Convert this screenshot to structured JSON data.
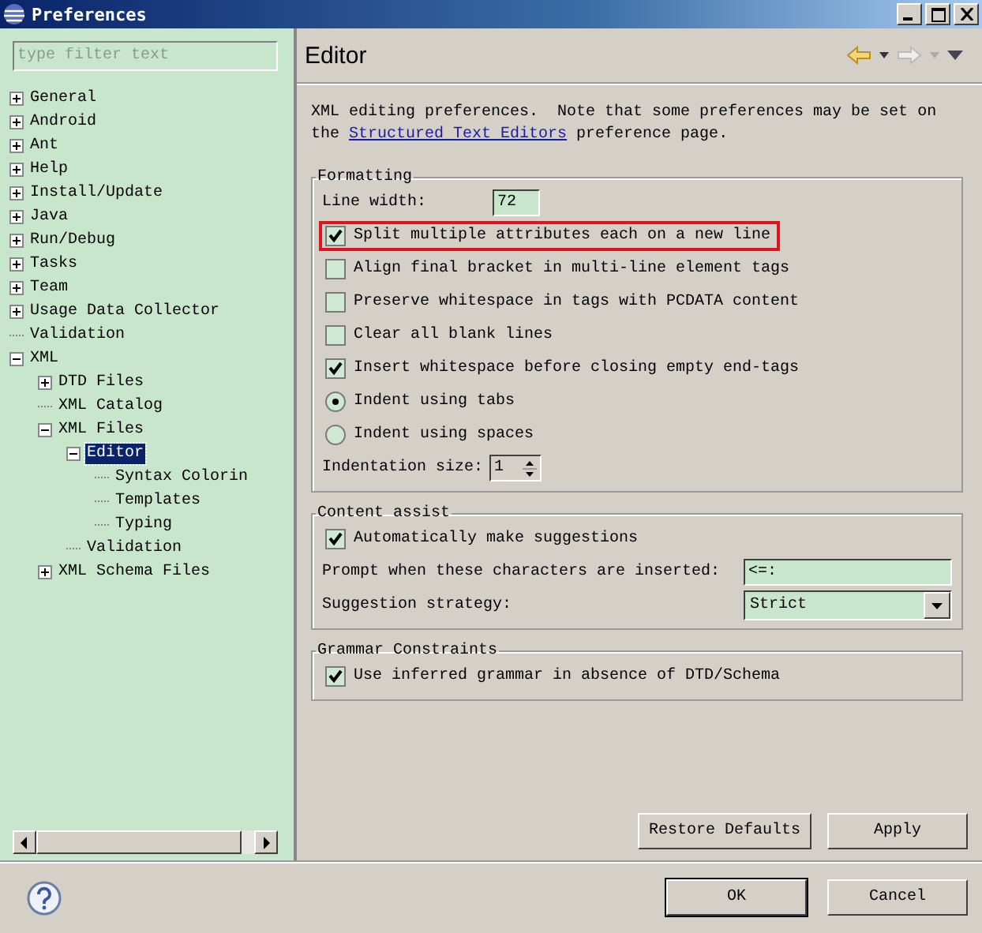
{
  "window": {
    "title": "Preferences"
  },
  "filter": {
    "placeholder": "type filter text"
  },
  "tree": {
    "items": [
      {
        "label": "General",
        "kind": "folder",
        "expanded": false,
        "selected": false
      },
      {
        "label": "Android",
        "kind": "folder",
        "expanded": false,
        "selected": false
      },
      {
        "label": "Ant",
        "kind": "folder",
        "expanded": false,
        "selected": false
      },
      {
        "label": "Help",
        "kind": "folder",
        "expanded": false,
        "selected": false
      },
      {
        "label": "Install/Update",
        "kind": "folder",
        "expanded": false,
        "selected": false
      },
      {
        "label": "Java",
        "kind": "folder",
        "expanded": false,
        "selected": false
      },
      {
        "label": "Run/Debug",
        "kind": "folder",
        "expanded": false,
        "selected": false
      },
      {
        "label": "Tasks",
        "kind": "folder",
        "expanded": false,
        "selected": false
      },
      {
        "label": "Team",
        "kind": "folder",
        "expanded": false,
        "selected": false
      },
      {
        "label": "Usage Data Collector",
        "kind": "folder",
        "expanded": false,
        "selected": false
      },
      {
        "label": "Validation",
        "kind": "leaf",
        "selected": false
      },
      {
        "label": "XML",
        "kind": "folder",
        "expanded": true,
        "selected": false,
        "children": [
          {
            "label": "DTD Files",
            "kind": "folder",
            "expanded": false,
            "selected": false
          },
          {
            "label": "XML Catalog",
            "kind": "leaf",
            "selected": false
          },
          {
            "label": "XML Files",
            "kind": "folder",
            "expanded": true,
            "selected": false,
            "children": [
              {
                "label": "Editor",
                "kind": "folder",
                "expanded": true,
                "selected": true,
                "children": [
                  {
                    "label": "Syntax Colorin",
                    "kind": "leaf",
                    "selected": false
                  },
                  {
                    "label": "Templates",
                    "kind": "leaf",
                    "selected": false
                  },
                  {
                    "label": "Typing",
                    "kind": "leaf",
                    "selected": false
                  }
                ]
              },
              {
                "label": "Validation",
                "kind": "leaf",
                "selected": false
              }
            ]
          },
          {
            "label": "XML Schema Files",
            "kind": "folder",
            "expanded": false,
            "selected": false
          }
        ]
      }
    ]
  },
  "page": {
    "title": "Editor",
    "description": [
      "XML editing preferences.  Note that some preferences may be set on ",
      "the ",
      "Structured Text Editors",
      " preference page."
    ],
    "groups": [
      {
        "title": "Formatting",
        "rows": [
          {
            "kind": "field",
            "label": "Line width:",
            "value": "72"
          },
          {
            "kind": "checkbox",
            "label": "Split multiple attributes each on a new line",
            "checked": true,
            "highlighted": true
          },
          {
            "kind": "checkbox",
            "label": "Align final bracket in multi-line element tags",
            "checked": false,
            "highlighted": false
          },
          {
            "kind": "checkbox",
            "label": "Preserve whitespace in tags with PCDATA content",
            "checked": false,
            "highlighted": false
          },
          {
            "kind": "checkbox",
            "label": "Clear all blank lines",
            "checked": false,
            "highlighted": false
          },
          {
            "kind": "checkbox",
            "label": "Insert whitespace before closing empty end-tags",
            "checked": true,
            "highlighted": false
          },
          {
            "kind": "radio",
            "label": "Indent using tabs",
            "selected": true
          },
          {
            "kind": "radio",
            "label": "Indent using spaces",
            "selected": false
          },
          {
            "kind": "spinner",
            "label": "Indentation size:",
            "value": "1"
          }
        ]
      },
      {
        "title": "Content assist",
        "rows": [
          {
            "kind": "checkbox",
            "label": "Automatically make suggestions",
            "checked": true,
            "highlighted": false
          },
          {
            "kind": "textfield",
            "label": "Prompt when these characters are inserted:",
            "value": "<=:"
          },
          {
            "kind": "dropdown",
            "label": "Suggestion strategy:",
            "value": "Strict"
          }
        ]
      },
      {
        "title": "Grammar Constraints",
        "rows": [
          {
            "kind": "checkbox",
            "label": "Use inferred grammar in absence of DTD/Schema",
            "checked": true,
            "highlighted": false
          }
        ]
      }
    ],
    "buttons": [
      "Restore Defaults",
      "Apply"
    ]
  },
  "footer": {
    "buttons": [
      "OK",
      "Cancel"
    ]
  }
}
